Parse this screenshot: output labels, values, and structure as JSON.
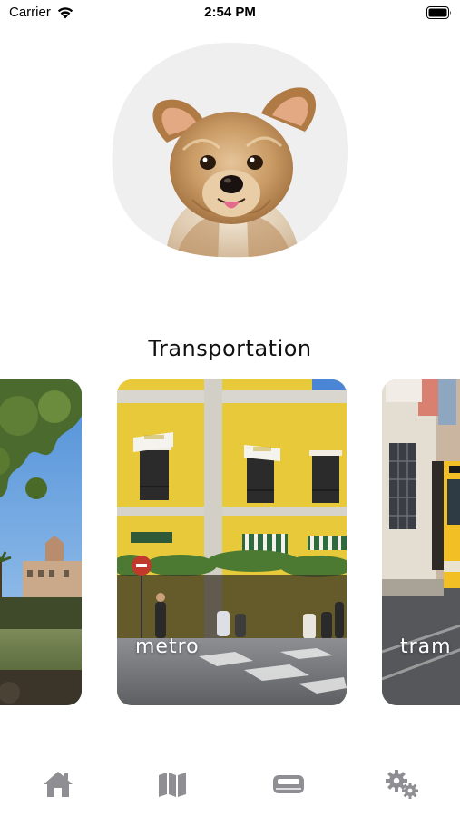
{
  "status_bar": {
    "carrier": "Carrier",
    "time": "2:54 PM"
  },
  "profile": {
    "avatar_icon": "yorkshire-terrier-avatar"
  },
  "section": {
    "title": "Transportation"
  },
  "cards": [
    {
      "label": "",
      "icon": "coastal-park-photo"
    },
    {
      "label": "metro",
      "icon": "yellow-building-photo"
    },
    {
      "label": "tram",
      "icon": "street-tram-photo"
    }
  ],
  "tab_bar": {
    "tabs": [
      {
        "icon": "home-icon"
      },
      {
        "icon": "map-icon"
      },
      {
        "icon": "transport-icon"
      },
      {
        "icon": "gear-icon"
      }
    ],
    "icon_color": "#8e8e93"
  }
}
